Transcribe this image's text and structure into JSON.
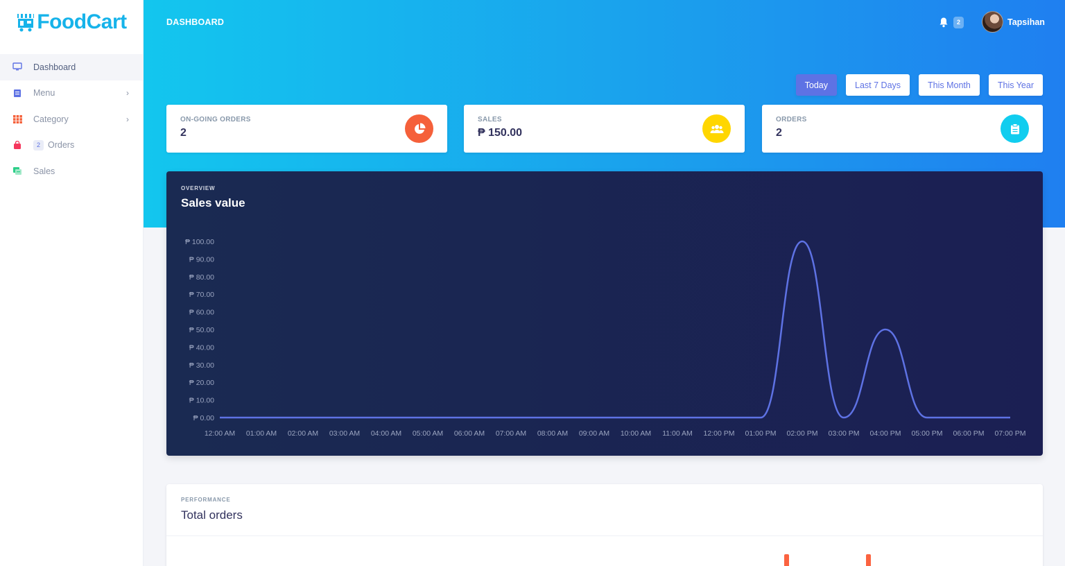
{
  "app": {
    "logo_text": "FoodCart",
    "page_title": "DASHBOARD",
    "brand_color": "#16b3ea"
  },
  "sidebar": {
    "items": [
      {
        "label": "Dashboard",
        "icon": "monitor-icon",
        "active": true
      },
      {
        "label": "Menu",
        "icon": "menu-book-icon",
        "has_children": true
      },
      {
        "label": "Category",
        "icon": "grid-icon",
        "has_children": true
      },
      {
        "label": "Orders",
        "icon": "bag-icon",
        "badge": "2"
      },
      {
        "label": "Sales",
        "icon": "sales-icon"
      }
    ]
  },
  "header": {
    "notifications_count": "2",
    "user_name": "Tapsihan"
  },
  "filters": [
    {
      "label": "Today",
      "active": true
    },
    {
      "label": "Last 7 Days"
    },
    {
      "label": "This Month"
    },
    {
      "label": "This Year"
    }
  ],
  "stats": [
    {
      "label": "ON-GOING ORDERS",
      "value": "2",
      "icon": "pie-chart-icon",
      "color": "#f5603a"
    },
    {
      "label": "SALES",
      "value": "₱ 150.00",
      "icon": "users-icon",
      "color": "#ffd600"
    },
    {
      "label": "ORDERS",
      "value": "2",
      "icon": "clipboard-icon",
      "color": "#11cdef"
    }
  ],
  "overview": {
    "overline": "OVERVIEW",
    "title": "Sales value"
  },
  "performance": {
    "overline": "PERFORMANCE",
    "title": "Total orders"
  },
  "chart_data": {
    "type": "line",
    "title": "Sales value",
    "categories": [
      "12:00 AM",
      "01:00 AM",
      "02:00 AM",
      "03:00 AM",
      "04:00 AM",
      "05:00 AM",
      "06:00 AM",
      "07:00 AM",
      "08:00 AM",
      "09:00 AM",
      "10:00 AM",
      "11:00 AM",
      "12:00 PM",
      "01:00 PM",
      "02:00 PM",
      "03:00 PM",
      "04:00 PM",
      "05:00 PM",
      "06:00 PM",
      "07:00 PM"
    ],
    "values": [
      0,
      0,
      0,
      0,
      0,
      0,
      0,
      0,
      0,
      0,
      0,
      0,
      0,
      0,
      100,
      0,
      50,
      0,
      0,
      0
    ],
    "y_ticks": [
      "₱ 0.00",
      "₱ 10.00",
      "₱ 20.00",
      "₱ 30.00",
      "₱ 40.00",
      "₱ 50.00",
      "₱ 60.00",
      "₱ 70.00",
      "₱ 80.00",
      "₱ 90.00",
      "₱ 100.00"
    ],
    "ylim": [
      0,
      100
    ],
    "line_color": "#5e72e4",
    "grid": false
  }
}
